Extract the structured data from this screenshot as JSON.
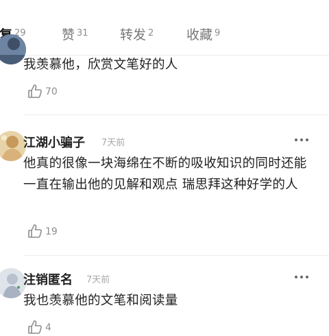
{
  "tabs": [
    {
      "label": "回复",
      "count": "29",
      "active": true
    },
    {
      "label": "赞",
      "count": "31",
      "active": false
    },
    {
      "label": "转发",
      "count": "2",
      "active": false
    },
    {
      "label": "收藏",
      "count": "9",
      "active": false
    }
  ],
  "comments": [
    {
      "text": "我羡慕他，欣赏文笔好的人",
      "likes": "70"
    },
    {
      "name": "江湖小骗子",
      "time": "7天前",
      "text": "他真的很像一块海绵在不断的吸收知识的同时还能一直在输出他的见解和观点 瑞思拜这种好学的人",
      "likes": "19"
    },
    {
      "name": "注销匿名",
      "time": "7天前",
      "text": "我也羡慕他的文笔和阅读量",
      "likes": "4"
    }
  ]
}
